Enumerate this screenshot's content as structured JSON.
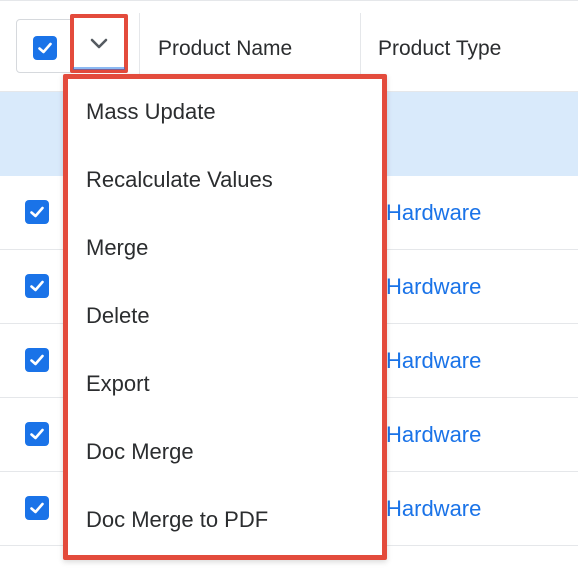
{
  "header": {
    "columns": [
      "Product Name",
      "Product Type"
    ]
  },
  "rows": [
    {
      "product_type": "Hardware"
    },
    {
      "product_type": "Hardware"
    },
    {
      "product_type": "Hardware"
    },
    {
      "product_type": "Hardware"
    },
    {
      "product_type": "Hardware"
    }
  ],
  "menu": {
    "items": [
      "Mass Update",
      "Recalculate Values",
      "Merge",
      "Delete",
      "Export",
      "Doc Merge",
      "Doc Merge to PDF"
    ]
  },
  "colors": {
    "accent": "#1a73e8",
    "highlight": "#e34b3c",
    "selected_row": "#d9eafb"
  }
}
